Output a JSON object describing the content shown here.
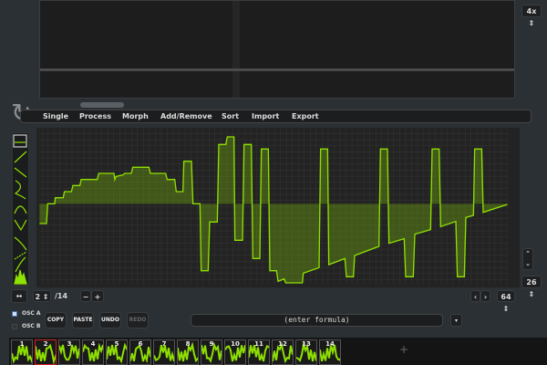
{
  "toolbar": {
    "zoom": "4x",
    "zoom_arrows": "⇕"
  },
  "menu": [
    "Single",
    "Process",
    "Morph",
    "Add/Remove",
    "Sort",
    "Import",
    "Export"
  ],
  "left_tools": [
    "line",
    "sine-half",
    "saw-up",
    "sine",
    "triangle",
    "saw-down",
    "curve",
    "ramp",
    "dot",
    "noise"
  ],
  "right": {
    "grid": "26"
  },
  "frame": {
    "current": "2",
    "total": "/14",
    "minus": "−",
    "plus": "+",
    "resolution": "64",
    "prev": "‹",
    "next": "›"
  },
  "osc": {
    "a": "OSC A",
    "b": "OSC B"
  },
  "buttons": {
    "copy": "COPY",
    "paste": "PASTE",
    "undo": "UNDO",
    "redo": "REDO"
  },
  "formula": {
    "placeholder": "(enter formula)",
    "menu": "▾"
  },
  "thumbnails": [
    "1",
    "2",
    "3",
    "4",
    "5",
    "6",
    "7",
    "8",
    "9",
    "10",
    "11",
    "12",
    "13",
    "14"
  ],
  "add_frame": "+",
  "colors": {
    "accent": "#8ee000",
    "selected": "#d42020"
  }
}
